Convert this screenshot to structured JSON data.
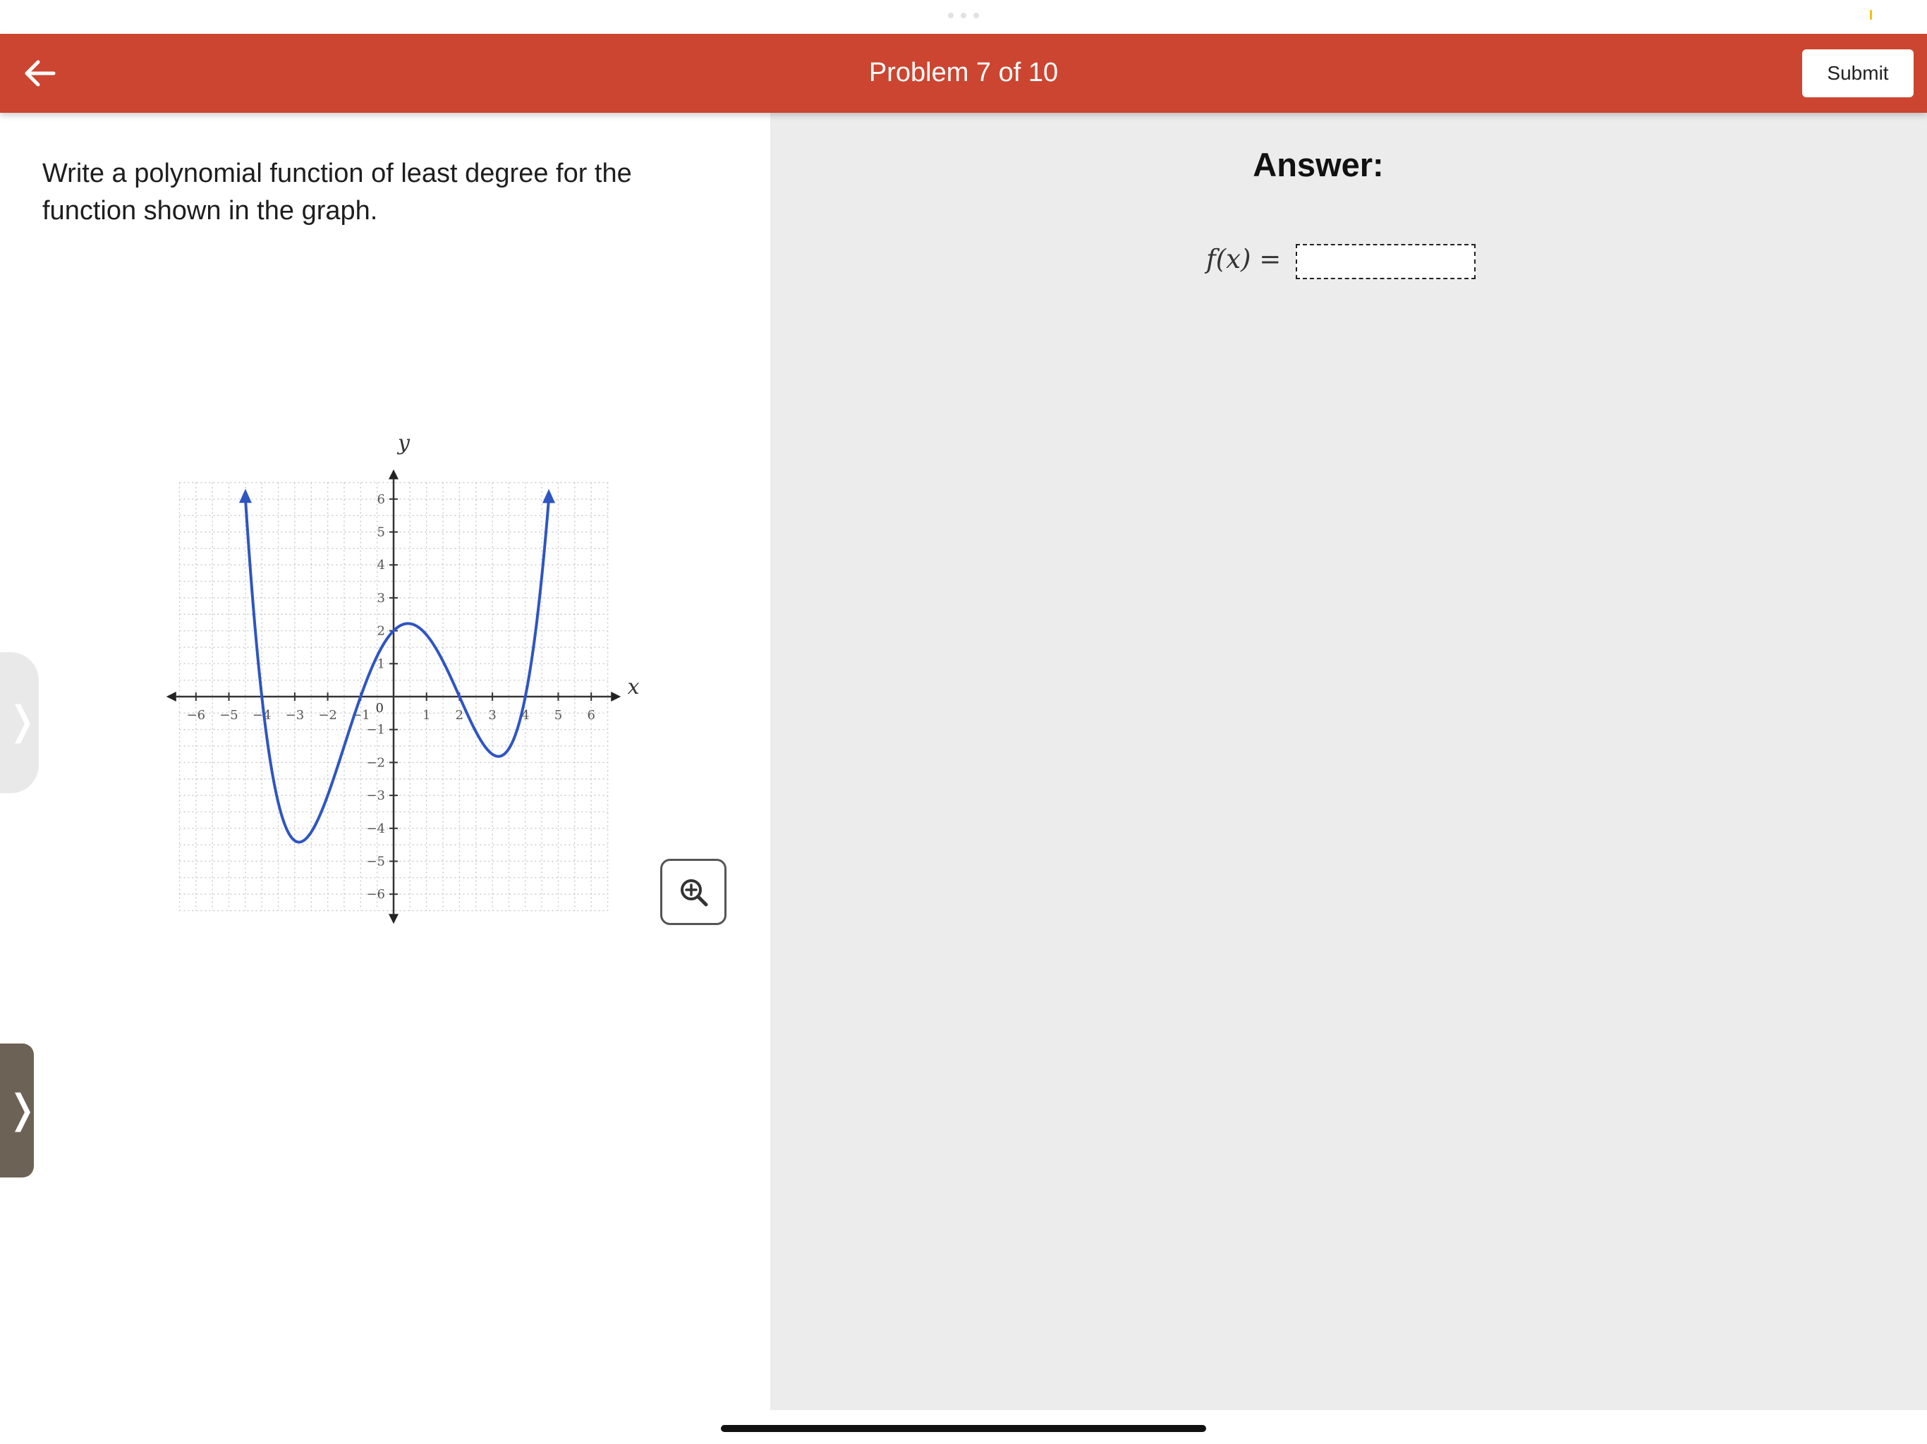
{
  "header": {
    "title": "Problem 7 of 10",
    "back_icon": "arrow-left-icon",
    "submit_label": "Submit",
    "background_color": "#cc4530"
  },
  "question": {
    "prompt": "Write a polynomial function of least degree for the function shown in the graph."
  },
  "graph": {
    "x_axis_label": "x",
    "y_axis_label": "y",
    "x_tick_labels": [
      "−6",
      "−5",
      "−4",
      "−3",
      "−2",
      "−1",
      "1",
      "2",
      "3",
      "4",
      "5",
      "6"
    ],
    "y_tick_labels": [
      "6",
      "5",
      "4",
      "3",
      "2",
      "1",
      "−1",
      "−2",
      "−3",
      "−4",
      "−5",
      "−6"
    ],
    "origin_label": "0",
    "x_range": [
      -6,
      6
    ],
    "y_range": [
      -6,
      6
    ],
    "grid": "dotted",
    "curve_color": "#2f55c2",
    "x_intercepts": [
      -4,
      -1,
      2,
      4
    ],
    "y_intercept": 2
  },
  "zoom": {
    "icon": "zoom-in-icon"
  },
  "answer": {
    "title": "Answer:",
    "function_label": "f(x) =",
    "input_value": ""
  },
  "edge_handles": {
    "icon": "chevron-right-icon"
  }
}
